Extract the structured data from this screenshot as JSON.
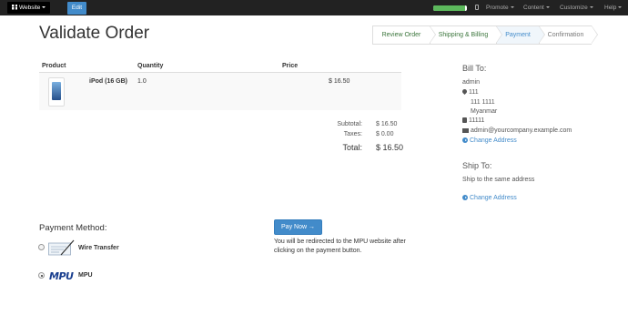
{
  "topbar": {
    "website_label": "Website",
    "edit_label": "Edit",
    "progress_fraction": 0.95,
    "nav": [
      "Promote",
      "Content",
      "Customize",
      "Help"
    ],
    "colors": {
      "bar": "#222222",
      "edit": "#428bca",
      "progress": "#5cb85c"
    }
  },
  "page": {
    "title": "Validate Order",
    "steps": [
      "Review Order",
      "Shipping & Billing",
      "Payment",
      "Confirmation"
    ],
    "active_step": "Payment"
  },
  "order": {
    "headers": {
      "product": "Product",
      "quantity": "Quantity",
      "price": "Price"
    },
    "line": {
      "name": "iPod (16 GB)",
      "quantity": "1.0",
      "price": "$ 16.50"
    },
    "subtotal_label": "Subtotal:",
    "subtotal": "$ 16.50",
    "taxes_label": "Taxes:",
    "taxes": "$ 0.00",
    "total_label": "Total:",
    "total": "$ 16.50"
  },
  "billing": {
    "heading": "Bill To:",
    "name": "admin",
    "street": "111",
    "street2": "111 1111",
    "country": "Myanmar",
    "phone": "11111",
    "email": "admin@yourcompany.example.com",
    "change_label": "Change Address"
  },
  "shipping": {
    "heading": "Ship To:",
    "note": "Ship to the same address",
    "change_label": "Change Address"
  },
  "payment": {
    "heading": "Payment Method:",
    "methods": [
      {
        "name": "Wire Transfer",
        "selected": false
      },
      {
        "name": "MPU",
        "logo_text": "MPU",
        "selected": true
      }
    ],
    "pay_button": "Pay Now →",
    "redirect_note": "You will be redirected to the MPU website after clicking on the payment button."
  }
}
